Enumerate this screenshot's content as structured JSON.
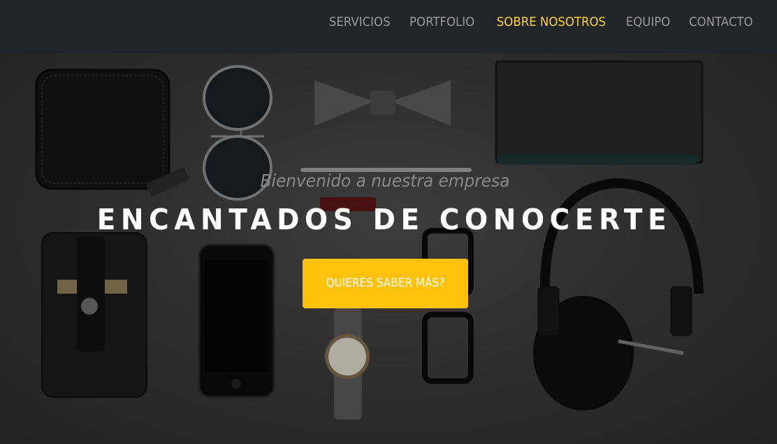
{
  "nav": {
    "items": [
      {
        "label": "SERVICIOS",
        "active": false
      },
      {
        "label": "PORTFOLIO",
        "active": false
      },
      {
        "label": "SOBRE NOSOTROS",
        "active": true
      },
      {
        "label": "EQUIPO",
        "active": false
      },
      {
        "label": "CONTACTO",
        "active": false
      }
    ]
  },
  "hero": {
    "subheading": "Bienvenido a nuestra empresa",
    "heading": "ENCANTADOS DE CONOCERTE",
    "cta_label": "QUIERES SABER MÁS?"
  },
  "colors": {
    "navbar_bg": "#212529",
    "nav_text": "#9a9a9a",
    "nav_active": "#fed136",
    "cta_bg": "#ffc10a"
  }
}
